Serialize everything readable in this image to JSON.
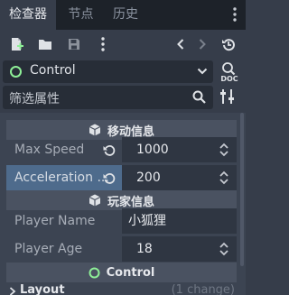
{
  "tabs": [
    {
      "label": "检查器",
      "active": true
    },
    {
      "label": "节点",
      "active": false
    },
    {
      "label": "历史",
      "active": false
    }
  ],
  "object": {
    "name": "Control",
    "color": "#8eef97",
    "icon": "control-circle-icon"
  },
  "doc_label": "DOC",
  "filter": {
    "placeholder": "筛选属性"
  },
  "sections": [
    {
      "title": "移动信息",
      "icon": "cube-icon"
    },
    {
      "title": "玩家信息",
      "icon": "cube-icon"
    },
    {
      "title": "Control",
      "icon": "control-circle-icon"
    }
  ],
  "properties": [
    {
      "name": "Max Speed",
      "value": "1000"
    },
    {
      "name": "Acceleration ...",
      "value": "200"
    },
    {
      "name": "Player Name",
      "value": "小狐狸"
    },
    {
      "name": "Player Age",
      "value": "18"
    }
  ],
  "layout_group": {
    "name": "Layout",
    "count": "(1 change)"
  }
}
